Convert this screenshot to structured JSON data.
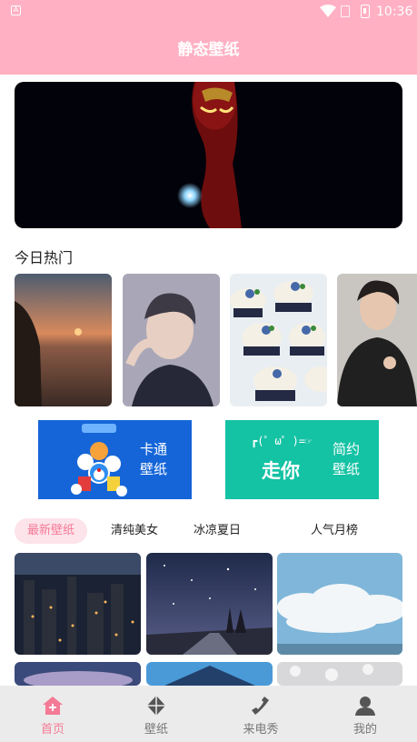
{
  "status_bar": {
    "time": "10:36",
    "notification_icon": "A"
  },
  "header": {
    "title": "静态壁纸"
  },
  "hot": {
    "title": "今日热门"
  },
  "promos": [
    {
      "line1": "卡通",
      "line2": "壁纸",
      "bg": "#1565d8"
    },
    {
      "line1": "简约",
      "line2": "壁纸",
      "bg": "#14c2a4",
      "art_text": "走你",
      "art_face": "┏(゜ω゜)=☞"
    }
  ],
  "tabs": [
    "最新壁纸",
    "清纯美女",
    "冰凉夏日",
    "人气月榜"
  ],
  "nav": [
    {
      "label": "首页",
      "icon": "home-icon"
    },
    {
      "label": "壁纸",
      "icon": "wallpaper-icon"
    },
    {
      "label": "来电秀",
      "icon": "phone-icon"
    },
    {
      "label": "我的",
      "icon": "user-icon"
    }
  ],
  "colors": {
    "accent": "#ffb0c3",
    "active": "#f47a96"
  }
}
